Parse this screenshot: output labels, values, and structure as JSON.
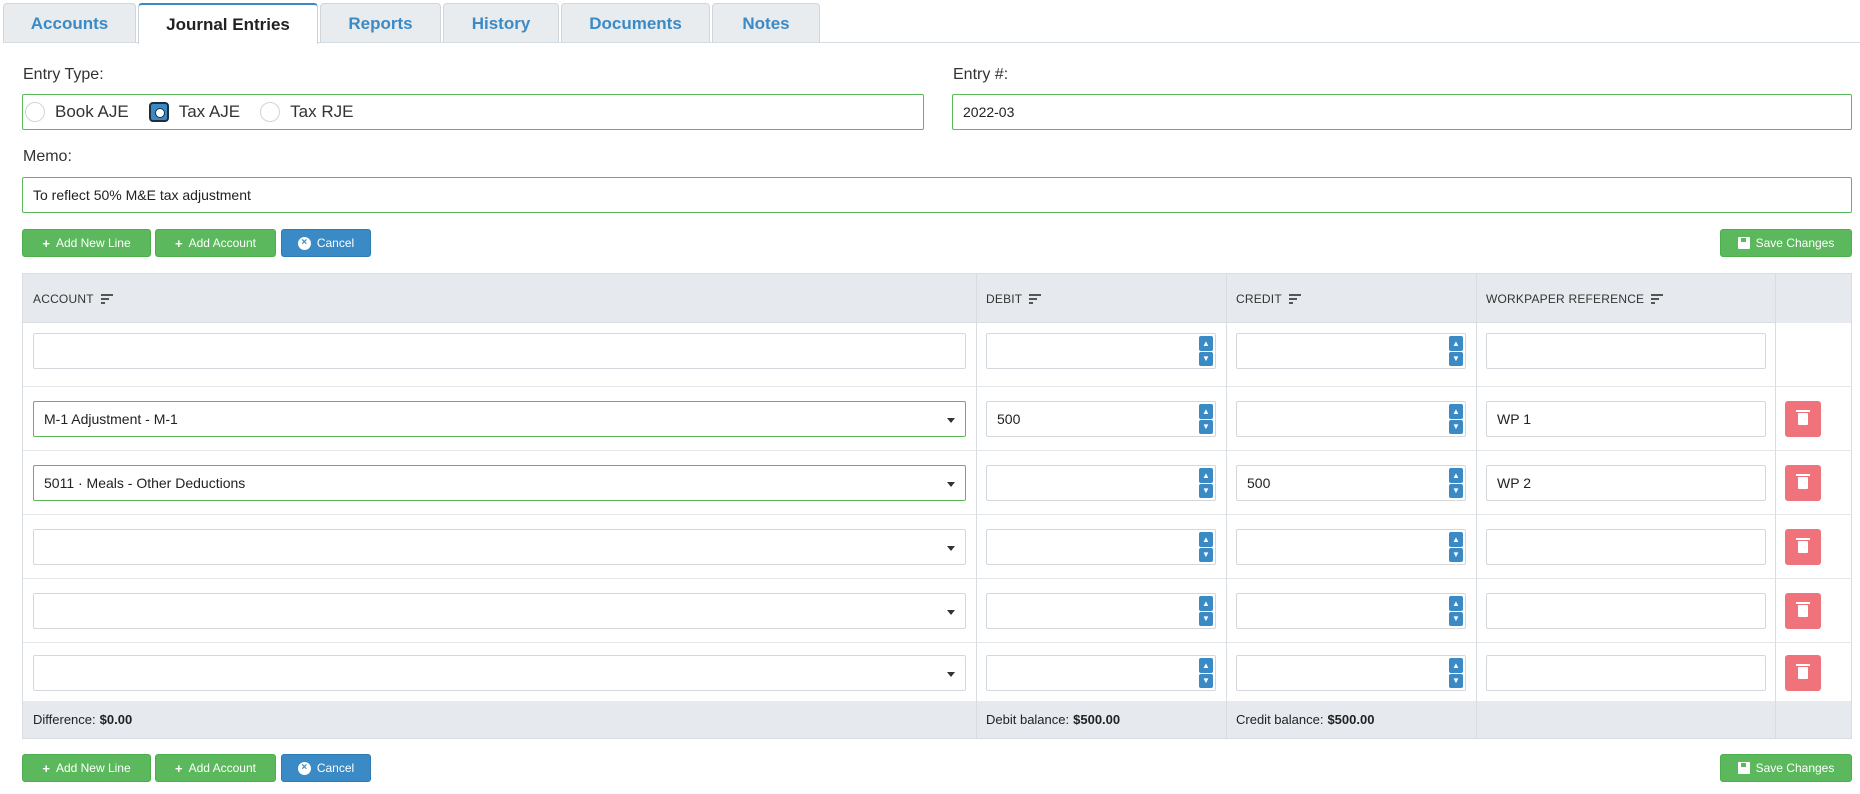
{
  "tabs": [
    {
      "label": "Accounts"
    },
    {
      "label": "Journal Entries"
    },
    {
      "label": "Reports"
    },
    {
      "label": "History"
    },
    {
      "label": "Documents"
    },
    {
      "label": "Notes"
    }
  ],
  "form": {
    "entry_type_label": "Entry Type:",
    "entry_type_options": [
      "Book AJE",
      "Tax AJE",
      "Tax RJE"
    ],
    "entry_type_selected": "Tax AJE",
    "entry_number_label": "Entry #:",
    "entry_number_value": "2022-03",
    "memo_label": "Memo:",
    "memo_value": "To reflect 50% M&E tax adjustment"
  },
  "toolbar": {
    "add_new_line": "Add New Line",
    "add_account": "Add Account",
    "cancel": "Cancel",
    "save_changes": "Save Changes"
  },
  "grid": {
    "columns": {
      "account": "ACCOUNT",
      "debit": "DEBIT",
      "credit": "CREDIT",
      "workpaper": "WORKPAPER REFERENCE"
    },
    "rows": [
      {
        "account": "M-1 Adjustment - M-1",
        "debit": "500",
        "credit": "",
        "workpaper": "WP 1"
      },
      {
        "account": "5011 · Meals - Other Deductions",
        "debit": "",
        "credit": "500",
        "workpaper": "WP 2"
      },
      {
        "account": "",
        "debit": "",
        "credit": "",
        "workpaper": ""
      },
      {
        "account": "",
        "debit": "",
        "credit": "",
        "workpaper": ""
      },
      {
        "account": "",
        "debit": "",
        "credit": "",
        "workpaper": ""
      }
    ],
    "footer": {
      "difference_label": "Difference:",
      "difference_value": "$0.00",
      "debit_balance_label": "Debit balance:",
      "debit_balance_value": "$500.00",
      "credit_balance_label": "Credit balance:",
      "credit_balance_value": "$500.00"
    }
  },
  "colors": {
    "accent_blue": "#3a8ac6",
    "success_green": "#5cb85c",
    "danger_red": "#f0737b",
    "header_grey": "#e6eaee"
  }
}
